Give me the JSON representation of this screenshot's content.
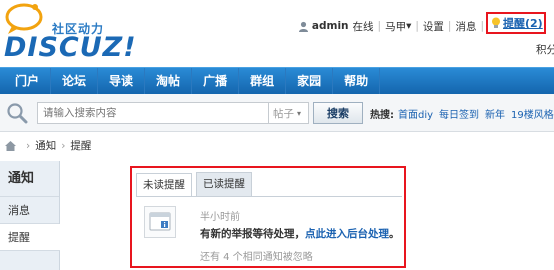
{
  "logo": {
    "tagline": "社区动力",
    "wordmark": "DISCUZ!"
  },
  "usernav": {
    "username": "admin",
    "status": "在线",
    "separator": "|",
    "mode": "马甲",
    "mode_caret": "▾",
    "settings": "设置",
    "messages": "消息",
    "reminders": "提醒(2)",
    "points": "积分"
  },
  "nav": {
    "items": [
      "门户",
      "论坛",
      "导读",
      "淘帖",
      "广播",
      "群组",
      "家园",
      "帮助"
    ]
  },
  "search": {
    "placeholder": "请输入搜索内容",
    "type": "帖子",
    "type_caret": "▾",
    "button": "搜索",
    "hot_label": "热搜:",
    "hot_links": [
      "首面diy",
      "每日签到",
      "新年",
      "19楼风格"
    ]
  },
  "breadcrumb": {
    "sep": "›",
    "items": [
      "通知",
      "提醒"
    ]
  },
  "sidebar": {
    "title": "通知",
    "items": [
      "消息",
      "提醒"
    ]
  },
  "tabs": [
    "未读提醒",
    "已读提醒"
  ],
  "notice": {
    "time": "半小时前",
    "text": "有新的举报等待处理，",
    "link": "点此进入后台处理",
    "end": "。",
    "more": "还有 4 个相同通知被忽略"
  },
  "colors": {
    "nav_blue": "#1b78c9",
    "highlight_red": "#e8151e",
    "link_blue": "#1b62b1"
  }
}
